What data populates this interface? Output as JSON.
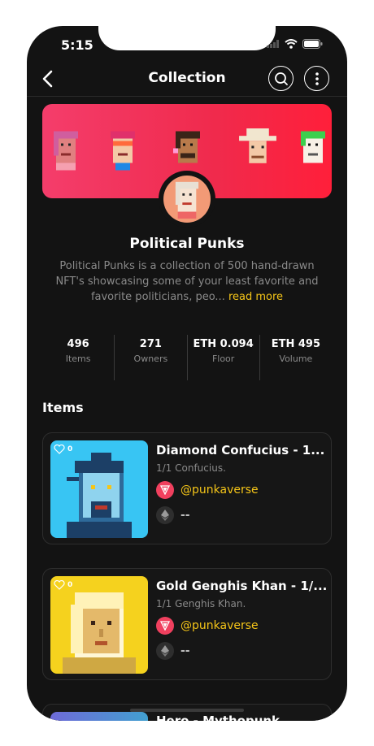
{
  "status": {
    "time": "5:15"
  },
  "header": {
    "title": "Collection"
  },
  "collection": {
    "name": "Political Punks",
    "description": "Political Punks is a collection of 500 hand-drawn NFT's showcasing some of your least favorite and favorite politicians, peo...",
    "read_more": "read more"
  },
  "stats": [
    {
      "value": "496",
      "label": "Items"
    },
    {
      "value": "271",
      "label": "Owners"
    },
    {
      "value": "ETH 0.094",
      "label": "Floor"
    },
    {
      "value": "ETH 495",
      "label": "Volume"
    }
  ],
  "items_title": "Items",
  "items": [
    {
      "name": "Diamond Confucius - 1...",
      "subtitle": "1/1 Confucius.",
      "owner": "@punkaverse",
      "price": "--",
      "likes": "0",
      "thumb_color": "#38c5f3"
    },
    {
      "name": "Gold Genghis Khan - 1/...",
      "subtitle": "1/1 Genghis Khan.",
      "owner": "@punkaverse",
      "price": "--",
      "likes": "0",
      "thumb_color": "#f5d21e"
    },
    {
      "name": "Hero - Mythopunk"
    }
  ],
  "colors": {
    "background": "#131313",
    "accent": "#f5c518",
    "banner": "#f43d6b"
  },
  "icons": [
    "back-arrow-icon",
    "search-icon",
    "more-vertical-icon",
    "heart-icon",
    "owner-logo-icon",
    "ethereum-icon",
    "wifi-icon",
    "battery-icon",
    "signal-icon"
  ]
}
